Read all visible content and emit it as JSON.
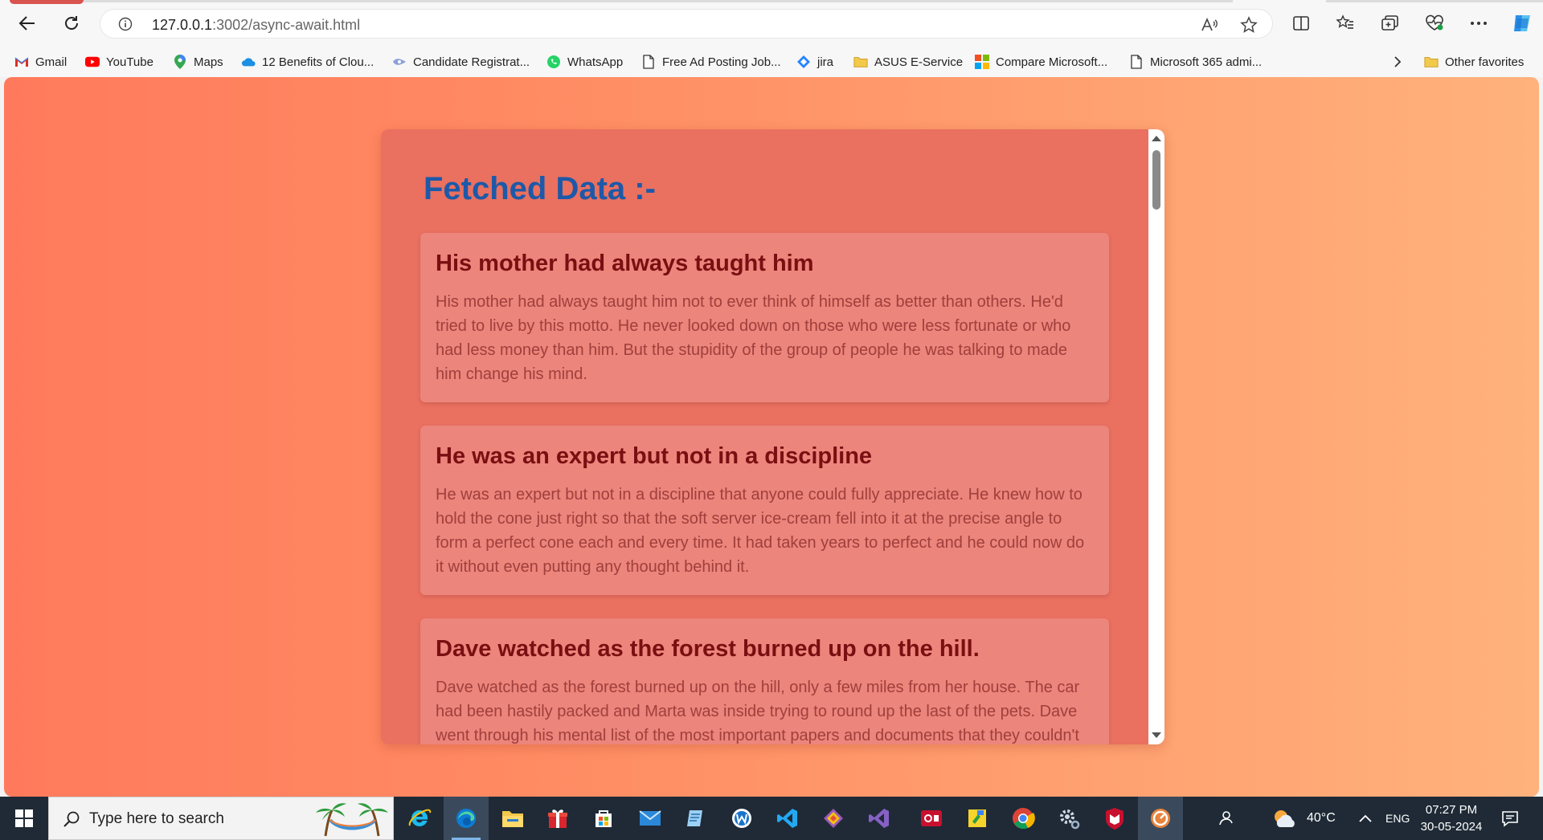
{
  "browser": {
    "url_host": "127.0.0.1",
    "url_path": ":3002/async-await.html"
  },
  "bookmarks": [
    {
      "label": "Gmail",
      "icon": "gmail-icon"
    },
    {
      "label": "YouTube",
      "icon": "youtube-icon"
    },
    {
      "label": "Maps",
      "icon": "maps-icon"
    },
    {
      "label": "12 Benefits of Clou...",
      "icon": "cloud-icon"
    },
    {
      "label": "Candidate Registrat...",
      "icon": "page-icon"
    },
    {
      "label": "WhatsApp",
      "icon": "whatsapp-icon"
    },
    {
      "label": "Free Ad Posting Job...",
      "icon": "document-icon"
    },
    {
      "label": "jira",
      "icon": "jira-icon"
    },
    {
      "label": "ASUS E-Service",
      "icon": "folder-icon"
    },
    {
      "label": "Compare Microsoft...",
      "icon": "microsoft-icon"
    },
    {
      "label": "Microsoft 365 admi...",
      "icon": "document-icon"
    }
  ],
  "other_favorites": "Other favorites",
  "page": {
    "heading": "Fetched Data :-",
    "posts": [
      {
        "title": "His mother had always taught him",
        "body": "His mother had always taught him not to ever think of himself as better than others. He'd tried to live by this motto. He never looked down on those who were less fortunate or who had less money than him. But the stupidity of the group of people he was talking to made him change his mind."
      },
      {
        "title": "He was an expert but not in a discipline",
        "body": "He was an expert but not in a discipline that anyone could fully appreciate. He knew how to hold the cone just right so that the soft server ice-cream fell into it at the precise angle to form a perfect cone each and every time. It had taken years to perfect and he could now do it without even putting any thought behind it."
      },
      {
        "title": "Dave watched as the forest burned up on the hill.",
        "body": "Dave watched as the forest burned up on the hill, only a few miles from her house. The car had been hastily packed and Marta was inside trying to round up the last of the pets. Dave went through his mental list of the most important papers and documents that they couldn't"
      }
    ]
  },
  "taskbar": {
    "search_placeholder": "Type here to search",
    "temperature": "40°C",
    "language": "ENG",
    "time": "07:27 PM",
    "date": "30-05-2024"
  },
  "colors": {
    "heading": "#1d59a8",
    "post_title": "#7a0f12",
    "post_body": "#a03f3c",
    "card_background": "#ea7060",
    "post_background": "#ec857b"
  }
}
